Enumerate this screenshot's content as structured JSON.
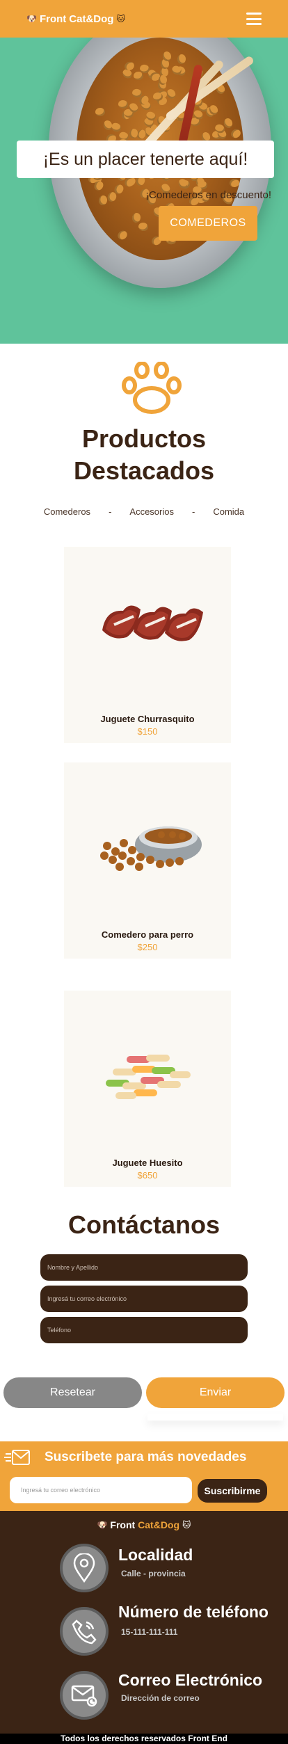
{
  "colors": {
    "accent": "#f0a43a",
    "brown": "#3b2415",
    "hero_green": "#5fc39b",
    "reset_gray": "#878787"
  },
  "navbar": {
    "brand_front": "Front",
    "brand_catdog": "Cat&Dog",
    "brand_dog_icon": "dog-face-icon",
    "brand_cat_icon": "cat-face-icon",
    "menu_icon": "hamburger-menu-icon"
  },
  "hero": {
    "welcome": "¡Es un placer tenerte aquí!",
    "promo": "¡Comederos en descuento!",
    "button": "COMEDEROS"
  },
  "products": {
    "title_line1": "Productos",
    "title_line2": "Destacados",
    "filters": [
      "Comederos",
      "-",
      "Accesorios",
      "-",
      "Comida"
    ],
    "items": [
      {
        "name": "Juguete Churrasquito",
        "price": "$150",
        "image": "steak-toy"
      },
      {
        "name": "Comedero para perro",
        "price": "$250",
        "image": "dog-bowl"
      },
      {
        "name": "Juguete Huesito",
        "price": "$650",
        "image": "bone-treats"
      }
    ]
  },
  "contact": {
    "title": "Contáctanos",
    "name_placeholder": "Nombre y Apellido",
    "email_placeholder": "Ingresá tu correo electrónico",
    "phone_placeholder": "Teléfono",
    "reset_label": "Resetear",
    "send_label": "Enviar"
  },
  "newsletter": {
    "title": "Suscribete para más novedades",
    "email_placeholder": "Ingresá tu correo electrónico",
    "submit_label": "Suscribirme"
  },
  "footer": {
    "brand_front": "Front",
    "brand_catdog": "Cat&Dog",
    "location_title": "Localidad",
    "location_sub": "Calle - provincia",
    "phone_title": "Número de teléfono",
    "phone_sub": "15-111-111-111",
    "email_title": "Correo Electrónico",
    "email_sub": "Dirección de correo",
    "copyright": "Todos los derechos reservados Front End"
  }
}
